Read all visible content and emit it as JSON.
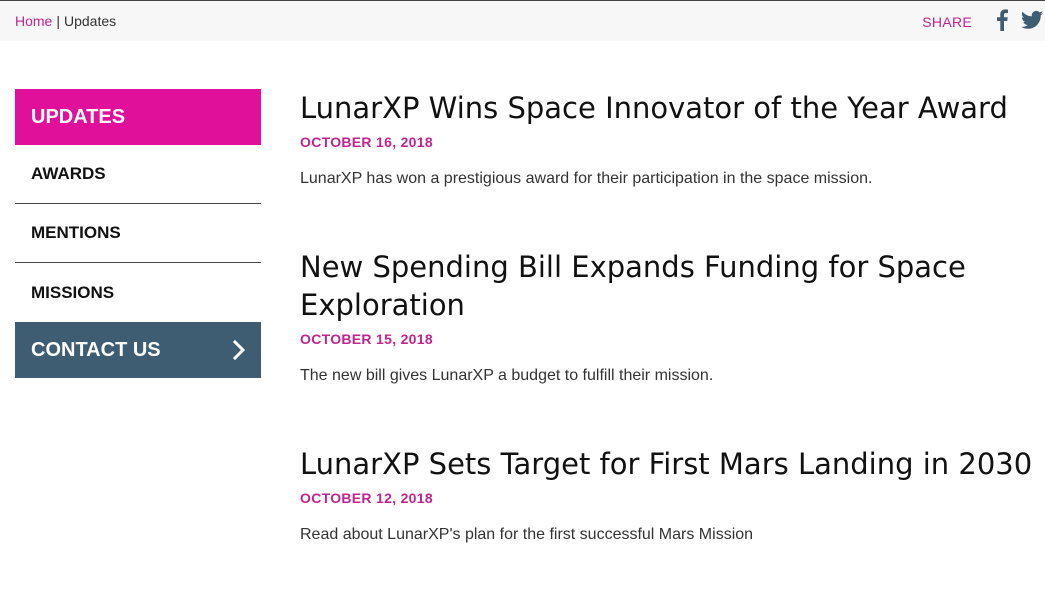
{
  "breadcrumb": {
    "home": "Home",
    "separator": "|",
    "current": "Updates"
  },
  "share": {
    "label": "SHARE",
    "icons": [
      "facebook-icon",
      "twitter-icon"
    ]
  },
  "sidebar": {
    "items": [
      {
        "label": "UPDATES"
      },
      {
        "label": "AWARDS"
      },
      {
        "label": "MENTIONS"
      },
      {
        "label": "MISSIONS"
      },
      {
        "label": "CONTACT US"
      }
    ]
  },
  "articles": [
    {
      "title": "LunarXP Wins Space Innovator of the Year Award",
      "date": "OCTOBER 16, 2018",
      "summary": "LunarXP has won a prestigious award for their participation in the space mission."
    },
    {
      "title": "New Spending Bill Expands Funding for Space Exploration",
      "date": "OCTOBER 15, 2018",
      "summary": "The new bill gives LunarXP a budget to fulfill their mission."
    },
    {
      "title": "LunarXP Sets Target for First Mars Landing in 2030",
      "date": "OCTOBER 12, 2018",
      "summary": "Read about LunarXP's plan for the first successful Mars Mission"
    }
  ],
  "colors": {
    "accent": "#e0109a",
    "link": "#c0248e",
    "contact_bg": "#3e5c72",
    "social": "#3e5c72"
  }
}
